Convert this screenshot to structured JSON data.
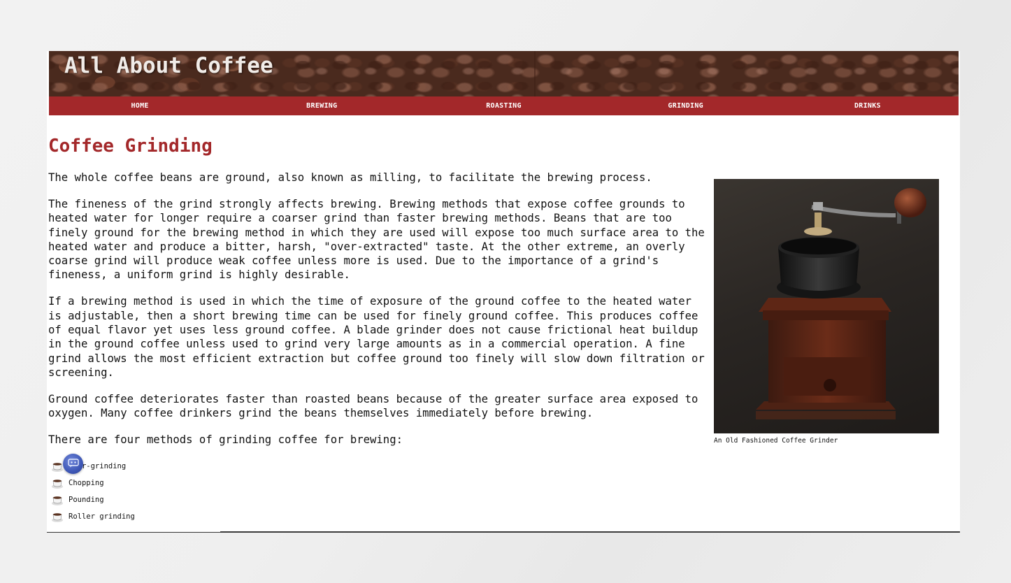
{
  "site": {
    "title": "All About Coffee"
  },
  "nav": [
    {
      "label": "HOME"
    },
    {
      "label": "BREWING"
    },
    {
      "label": "ROASTING"
    },
    {
      "label": "GRINDING"
    },
    {
      "label": "DRINKS"
    }
  ],
  "main": {
    "heading": "Coffee Grinding",
    "paragraphs": [
      "The whole coffee beans are ground, also known as milling, to facilitate the brewing process.",
      "The fineness of the grind strongly affects brewing. Brewing methods that expose coffee grounds to heated water for longer require a coarser grind than faster brewing methods. Beans that are too finely ground for the brewing method in which they are used will expose too much surface area to the heated water and produce a bitter, harsh, \"over-extracted\" taste. At the other extreme, an overly coarse grind will produce weak coffee unless more is used. Due to the importance of a grind's fineness, a uniform grind is highly desirable.",
      "If a brewing method is used in which the time of exposure of the ground coffee to the heated water is adjustable, then a short brewing time can be used for finely ground coffee. This produces coffee of equal flavor yet uses less ground coffee. A blade grinder does not cause frictional heat buildup in the ground coffee unless used to grind very large amounts as in a commercial operation. A fine grind allows the most efficient extraction but coffee ground too finely will slow down filtration or screening.",
      "Ground coffee deteriorates faster than roasted beans because of the greater surface area exposed to oxygen. Many coffee drinkers grind the beans themselves immediately before brewing.",
      "There are four methods of grinding coffee for brewing:"
    ],
    "methods": [
      {
        "label": "Burr-grinding"
      },
      {
        "label": "Chopping"
      },
      {
        "label": "Pounding"
      },
      {
        "label": "Roller grinding"
      }
    ],
    "figure": {
      "caption": "An Old Fashioned Coffee Grinder"
    }
  },
  "icons": {
    "list_bullet": "coffee-cup-icon",
    "floating_button": "assistant-icon"
  },
  "colors": {
    "accent": "#a3282a",
    "background": "#ececec",
    "page": "#ffffff"
  }
}
